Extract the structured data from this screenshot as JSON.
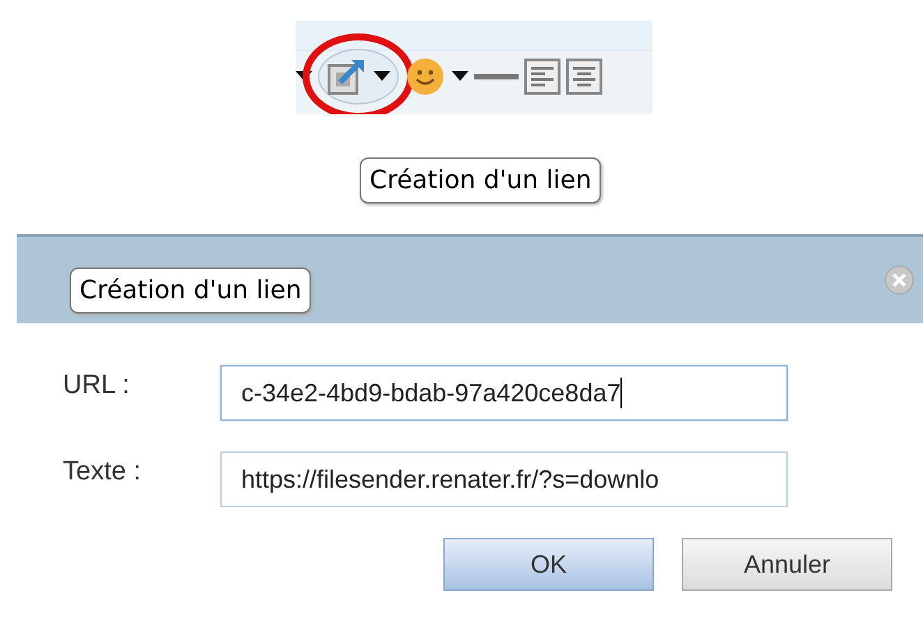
{
  "toolbar": {
    "items": [
      {
        "kind": "caret",
        "highlighted": false,
        "circled": false
      },
      {
        "kind": "link",
        "highlighted": true,
        "circled": true
      },
      {
        "kind": "smiley",
        "highlighted": false,
        "circled": false
      },
      {
        "kind": "caret",
        "highlighted": false,
        "circled": false
      },
      {
        "kind": "rule",
        "highlighted": false,
        "circled": false
      },
      {
        "kind": "align-left",
        "highlighted": false,
        "circled": false
      },
      {
        "kind": "align-center",
        "highlighted": false,
        "circled": false
      }
    ]
  },
  "tooltips": [
    "Création d'un lien",
    "Création d'un lien"
  ],
  "dialog": {
    "fields": [
      {
        "label": "URL :",
        "value": "c-34e2-4bd9-bdab-97a420ce8da7",
        "focused": true
      },
      {
        "label": "Texte :",
        "value": "https://filesender.renater.fr/?s=downlo",
        "focused": false
      }
    ],
    "buttons": [
      {
        "label": "OK",
        "kind": "primary"
      },
      {
        "label": "Annuler",
        "kind": "secondary"
      }
    ]
  }
}
